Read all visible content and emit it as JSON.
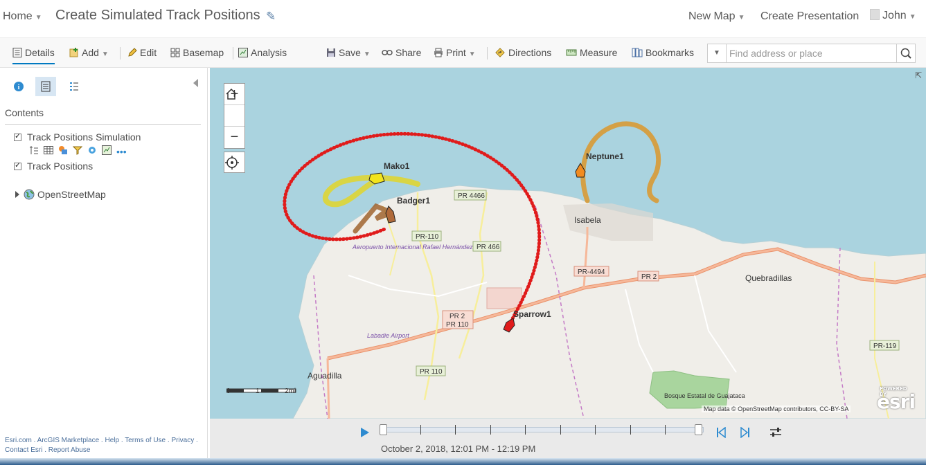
{
  "header": {
    "home_label": "Home",
    "title": "Create Simulated Track Positions",
    "new_map_label": "New Map",
    "create_presentation_label": "Create Presentation",
    "user_name": "John"
  },
  "toolbar": {
    "details": "Details",
    "add": "Add",
    "edit": "Edit",
    "basemap": "Basemap",
    "analysis": "Analysis",
    "save": "Save",
    "share": "Share",
    "print": "Print",
    "directions": "Directions",
    "measure": "Measure",
    "bookmarks": "Bookmarks",
    "search_placeholder": "Find address or place"
  },
  "panel": {
    "contents_title": "Contents",
    "layers": [
      {
        "label": "Track Positions Simulation",
        "checked": true
      },
      {
        "label": "Track Positions",
        "checked": true
      }
    ],
    "basemap_layer": "OpenStreetMap",
    "footer_line1": "Esri.com . ArcGIS Marketplace . Help . Terms of Use . Privacy .",
    "footer_line2": "Contact Esri . Report Abuse"
  },
  "map": {
    "tracks": [
      {
        "name": "Mako1",
        "color": "#f2e41c"
      },
      {
        "name": "Badger1",
        "color": "#a0642f"
      },
      {
        "name": "Neptune1",
        "color": "#e8931f"
      },
      {
        "name": "Sparrow1",
        "color": "#e01b1b"
      }
    ],
    "places": {
      "isabela": "Isabela",
      "quebradillas": "Quebradillas",
      "aguadilla": "Aguadilla",
      "airport": "Aeropuerto Internacional Rafael Hernández",
      "labadie": "Labadie Airport",
      "bosque": "Bosque Estatal de Guajataca"
    },
    "roads": {
      "pr4466": "PR 4466",
      "pr110a": "PR-110",
      "pr466": "PR 466",
      "pr4494": "PR-4494",
      "pr2": "PR 2",
      "pr2_110_line1": "PR 2",
      "pr2_110_line2": "PR 110",
      "pr110b": "PR 110",
      "pr119": "PR-119"
    },
    "scale_labels": [
      "0",
      "1",
      "2mi"
    ],
    "attribution": "Map data © OpenStreetMap contributors, CC-BY-SA",
    "esri_powered": "POWERED BY",
    "esri_logo": "esri"
  },
  "time_slider": {
    "range_text": "October 2, 2018, 12:01 PM - 12:19 PM",
    "start_fraction": 0.0,
    "end_fraction": 1.0
  }
}
